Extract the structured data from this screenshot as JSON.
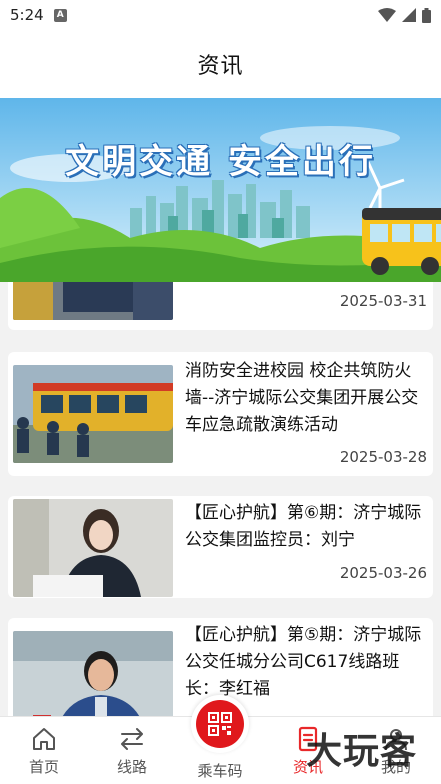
{
  "status_bar": {
    "time": "5:24",
    "notif_badge": "A"
  },
  "header": {
    "title": "资讯"
  },
  "banner": {
    "slogan": "文明交通 安全出行"
  },
  "news": [
    {
      "date": "2025-03-31"
    },
    {
      "title": "消防安全进校园 校企共筑防火墙--济宁城际公交集团开展公交车应急疏散演练活动",
      "date": "2025-03-28"
    },
    {
      "title": "【匠心护航】第⑥期：济宁城际公交集团监控员：刘宁",
      "date": "2025-03-26"
    },
    {
      "title": "【匠心护航】第⑤期：济宁城际公交任城分公司C617线路班长：李红福"
    }
  ],
  "nav": {
    "items": [
      {
        "label": "首页",
        "icon": "home-icon"
      },
      {
        "label": "线路",
        "icon": "route-icon"
      },
      {
        "label": "乘车码",
        "icon": "qr-code-icon"
      },
      {
        "label": "资讯",
        "icon": "news-icon",
        "active": true
      },
      {
        "label": "我的",
        "icon": "profile-icon"
      }
    ],
    "active_color": "#e8282a"
  },
  "watermark": {
    "text": "大玩客"
  }
}
